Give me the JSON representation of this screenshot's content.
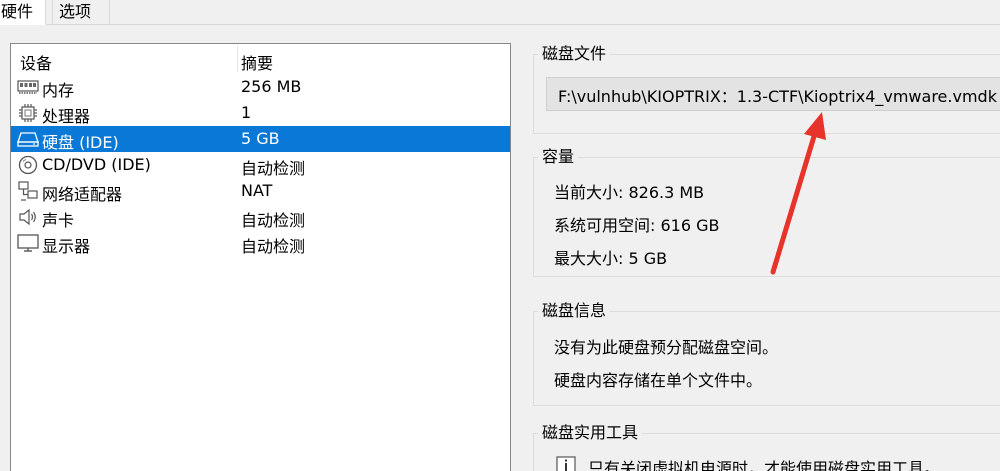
{
  "tabs": [
    {
      "label": "硬件"
    },
    {
      "label": "选项"
    }
  ],
  "devices": {
    "header": {
      "device": "设备",
      "summary": "摘要"
    },
    "rows": [
      {
        "name": "内存",
        "summary": "256 MB",
        "icon": "memory-icon"
      },
      {
        "name": "处理器",
        "summary": "1",
        "icon": "processor-icon"
      },
      {
        "name": "硬盘 (IDE)",
        "summary": "5 GB",
        "icon": "hard-disk-icon",
        "selected": true
      },
      {
        "name": "CD/DVD (IDE)",
        "summary": "自动检测",
        "icon": "cd-dvd-icon"
      },
      {
        "name": "网络适配器",
        "summary": "NAT",
        "icon": "network-adapter-icon"
      },
      {
        "name": "声卡",
        "summary": "自动检测",
        "icon": "sound-card-icon"
      },
      {
        "name": "显示器",
        "summary": "自动检测",
        "icon": "display-icon"
      }
    ]
  },
  "disk_file": {
    "title": "磁盘文件",
    "path": "F:\\vulnhub\\KIOPTRIX：1.3-CTF\\Kioptrix4_vmware.vmdk"
  },
  "capacity": {
    "title": "容量",
    "current_size": "当前大小: 826.3 MB",
    "available_space": "系统可用空间: 616 GB",
    "max_size": "最大大小: 5 GB"
  },
  "disk_info": {
    "title": "磁盘信息",
    "line1": "没有为此硬盘预分配磁盘空间。",
    "line2": "硬盘内容存储在单个文件中。"
  },
  "disk_utilities": {
    "title": "磁盘实用工具",
    "note": "只有关闭虚拟机电源时，才能使用磁盘实用工具。",
    "note_icon": "info-icon"
  },
  "colors": {
    "selection": "#0a78d7",
    "annotation_arrow": "#e8332a"
  }
}
